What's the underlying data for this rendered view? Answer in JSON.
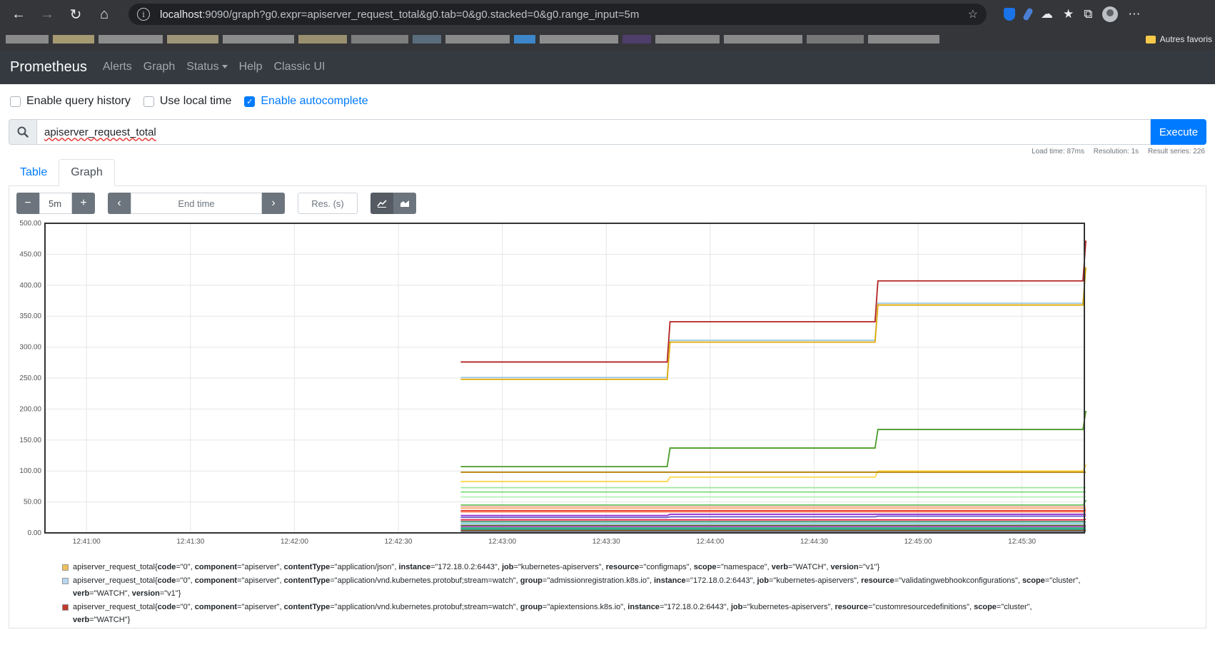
{
  "browser": {
    "url_host": "localhost",
    "url_rest": ":9090/graph?g0.expr=apiserver_request_total&g0.tab=0&g0.stacked=0&g0.range_input=5m",
    "bookmark_folder": "Autres favoris"
  },
  "nav": {
    "brand": "Prometheus",
    "links": [
      "Alerts",
      "Graph",
      "Status",
      "Help",
      "Classic UI"
    ]
  },
  "options": {
    "query_history": "Enable query history",
    "local_time": "Use local time",
    "autocomplete": "Enable autocomplete"
  },
  "query": {
    "expr": "apiserver_request_total",
    "execute": "Execute",
    "load_time": "Load time: 87ms",
    "resolution": "Resolution: 1s",
    "result_series": "Result series: 226"
  },
  "tabs": {
    "table": "Table",
    "graph": "Graph"
  },
  "controls": {
    "range": "5m",
    "end_time_placeholder": "End time",
    "res_placeholder": "Res. (s)"
  },
  "colors": {
    "accent": "#007bff",
    "navbar": "#343a40"
  },
  "chart_data": {
    "type": "line",
    "ylim": [
      0,
      500
    ],
    "yticks": [
      "0.00",
      "50.00",
      "100.00",
      "150.00",
      "200.00",
      "250.00",
      "300.00",
      "350.00",
      "400.00",
      "450.00",
      "500.00"
    ],
    "xticks": [
      "12:41:00",
      "12:41:30",
      "12:42:00",
      "12:42:30",
      "12:43:00",
      "12:43:30",
      "12:44:00",
      "12:44:30",
      "12:45:00",
      "12:45:30"
    ],
    "x_start": "12:40:48",
    "x_end": "12:45:48",
    "data_start": "12:42:48",
    "step_times": [
      "12:43:48",
      "12:44:48",
      "12:45:48"
    ],
    "series": [
      {
        "color": "#b22222",
        "values": [
          276,
          341,
          407,
          471
        ]
      },
      {
        "color": "#9ecae1",
        "values": [
          251,
          311,
          371,
          428
        ]
      },
      {
        "color": "#e0a800",
        "values": [
          248,
          308,
          368,
          428
        ]
      },
      {
        "color": "#4a9c2a",
        "values": [
          107,
          137,
          167,
          196
        ]
      },
      {
        "color": "#ffd84d",
        "values": [
          83,
          90,
          100,
          109
        ]
      },
      {
        "color": "#b8860b",
        "values": [
          98,
          98,
          98,
          98
        ]
      },
      {
        "color": "#9de69d",
        "values": [
          73,
          73,
          73,
          73
        ]
      },
      {
        "color": "#7fe07f",
        "values": [
          66,
          66,
          66,
          66
        ]
      },
      {
        "color": "#b5f2b5",
        "values": [
          58,
          58,
          58,
          58
        ]
      },
      {
        "color": "#66cc66",
        "values": [
          45,
          45,
          45,
          52
        ]
      },
      {
        "color": "#ffb3b3",
        "values": [
          43,
          43,
          43,
          43
        ]
      },
      {
        "color": "#f4a460",
        "values": [
          40,
          40,
          40,
          40
        ]
      },
      {
        "color": "#e03a3a",
        "values": [
          36,
          36,
          36,
          37
        ]
      },
      {
        "color": "#ff7f50",
        "values": [
          34,
          34,
          34,
          34
        ]
      },
      {
        "color": "#9932cc",
        "values": [
          28,
          30,
          30,
          30
        ]
      },
      {
        "color": "#6a5acd",
        "values": [
          25,
          26,
          27,
          27
        ]
      },
      {
        "color": "#dc143c",
        "values": [
          21,
          21,
          21,
          22
        ]
      },
      {
        "color": "#2e8b57",
        "values": [
          18,
          18,
          18,
          18
        ]
      },
      {
        "color": "#87ceeb",
        "values": [
          15,
          15,
          15,
          15
        ]
      },
      {
        "color": "#556b2f",
        "values": [
          12,
          12,
          12,
          12
        ]
      },
      {
        "color": "#ba55d3",
        "values": [
          10,
          10,
          10,
          10
        ]
      },
      {
        "color": "#3cb371",
        "values": [
          8,
          8,
          8,
          8
        ]
      },
      {
        "color": "#20b2aa",
        "values": [
          6,
          6,
          6,
          6
        ]
      },
      {
        "color": "#8b4513",
        "values": [
          4,
          4,
          4,
          4
        ]
      },
      {
        "color": "#708090",
        "values": [
          2,
          2,
          2,
          2
        ]
      }
    ]
  },
  "legend": [
    {
      "color": "#f0c05a",
      "prefix": "apiserver_request_total{",
      "labels": [
        [
          "code",
          "\"0\""
        ],
        [
          "component",
          "\"apiserver\""
        ],
        [
          "contentType",
          "\"application/json\""
        ],
        [
          "instance",
          "\"172.18.0.2:6443\""
        ],
        [
          "job",
          "\"kubernetes-apiservers\""
        ],
        [
          "resource",
          "\"configmaps\""
        ],
        [
          "scope",
          "\"namespace\""
        ],
        [
          "verb",
          "\"WATCH\""
        ],
        [
          "version",
          "\"v1\""
        ]
      ]
    },
    {
      "color": "#b7d7f0",
      "prefix": "apiserver_request_total{",
      "labels": [
        [
          "code",
          "\"0\""
        ],
        [
          "component",
          "\"apiserver\""
        ],
        [
          "contentType",
          "\"application/vnd.kubernetes.protobuf;stream=watch\""
        ],
        [
          "group",
          "\"admissionregistration.k8s.io\""
        ],
        [
          "instance",
          "\"172.18.0.2:6443\""
        ],
        [
          "job",
          "\"kubernetes-apiservers\""
        ],
        [
          "resource",
          "\"validatingwebhookconfigurations\""
        ],
        [
          "scope",
          "\"cluster\""
        ],
        [
          "verb",
          "\"WATCH\""
        ],
        [
          "version",
          "\"v1\""
        ]
      ]
    },
    {
      "color": "#c0392b",
      "prefix": "apiserver_request_total{",
      "labels": [
        [
          "code",
          "\"0\""
        ],
        [
          "component",
          "\"apiserver\""
        ],
        [
          "contentType",
          "\"application/vnd.kubernetes.protobuf;stream=watch\""
        ],
        [
          "group",
          "\"apiextensions.k8s.io\""
        ],
        [
          "instance",
          "\"172.18.0.2:6443\""
        ],
        [
          "job",
          "\"kubernetes-apiservers\""
        ],
        [
          "resource",
          "\"customresourcedefinitions\""
        ],
        [
          "scope",
          "\"cluster\""
        ],
        [
          "verb",
          "\"WATCH\""
        ]
      ]
    }
  ]
}
